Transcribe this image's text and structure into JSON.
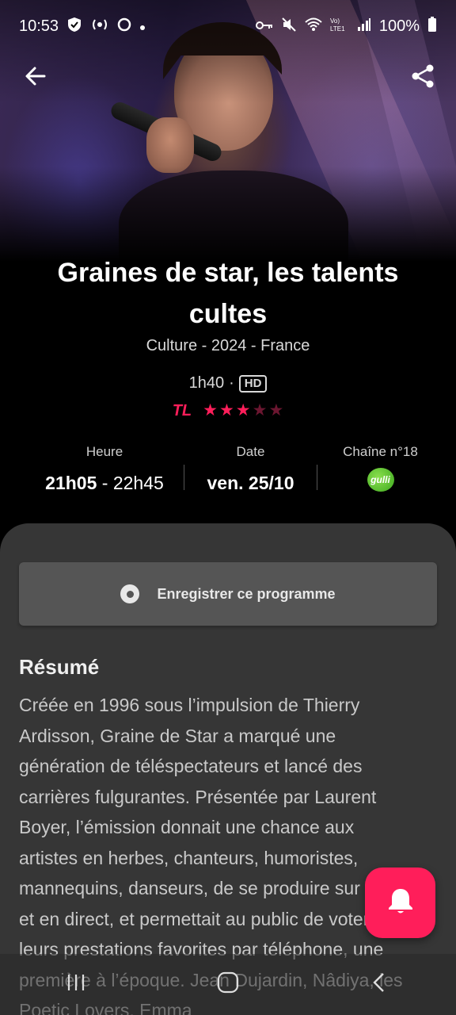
{
  "status_bar": {
    "time": "10:53",
    "battery": "100%",
    "left_icons": [
      "shield-check-icon",
      "nfc-icon",
      "sync-icon",
      "dot-icon"
    ],
    "right_icons": [
      "vpn-key-icon",
      "mute-icon",
      "wifi-icon",
      "volte-icon",
      "signal-icon",
      "battery-icon"
    ]
  },
  "header": {
    "back_icon": "arrow-back-icon",
    "share_icon": "share-icon"
  },
  "program": {
    "title": "Graines de star, les talents cultes",
    "meta": "Culture - 2024 - France",
    "duration": "1h40",
    "duration_sep": "·",
    "quality": "HD",
    "rating_source": "TL",
    "rating": 3,
    "rating_max": 5
  },
  "info": {
    "time_label": "Heure",
    "time_start": "21h05",
    "time_sep": " - ",
    "time_end": "22h45",
    "date_label": "Date",
    "date_value": "ven. 25/10",
    "channel_label": "Chaîne n°18",
    "channel_logo": "gulli"
  },
  "actions": {
    "record_label": "Enregistrer ce programme"
  },
  "summary": {
    "title": "Résumé",
    "text": "Créée en 1996 sous l’impulsion de Thierry Ardisson, Graine de Star a marqué une génération de téléspectateurs et lancé des carrières fulgurantes. Présentée par Laurent Boyer, l’émission donnait une chance aux artistes en herbes, chanteurs, humoristes, mannequins, danseurs, de se produire sur scène et en direct, et permettait au public de voter pour leurs prestations favorites par téléphone, une première à l’époque. Jean Dujardin, Nâdiya, les Poetic Lovers, Emma"
  },
  "colors": {
    "accent": "#ff1e5a",
    "sheet_bg": "#363636",
    "button_bg": "#555555",
    "channel_green": "#3ca81e"
  },
  "fab": {
    "icon": "bell-icon"
  },
  "navbar": {
    "icons": [
      "recent-apps-icon",
      "home-icon",
      "back-icon"
    ]
  }
}
